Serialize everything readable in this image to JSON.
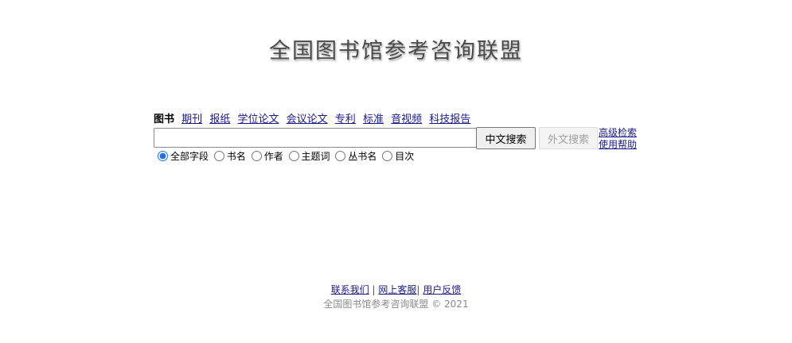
{
  "site": {
    "title": "全国图书馆参考咨询联盟"
  },
  "tabs": [
    {
      "label": "图书",
      "active": true
    },
    {
      "label": "期刊"
    },
    {
      "label": "报纸"
    },
    {
      "label": "学位论文"
    },
    {
      "label": "会议论文"
    },
    {
      "label": "专利"
    },
    {
      "label": "标准"
    },
    {
      "label": "音视频"
    },
    {
      "label": "科技报告"
    }
  ],
  "search": {
    "value": "",
    "placeholder": "",
    "chinese_button": "中文搜索",
    "foreign_button": "外文搜索",
    "advanced_link": "高级检索",
    "help_link": "使用帮助"
  },
  "fields": [
    {
      "label": "全部字段",
      "checked": true
    },
    {
      "label": "书名",
      "checked": false
    },
    {
      "label": "作者",
      "checked": false
    },
    {
      "label": "主题词",
      "checked": false
    },
    {
      "label": "丛书名",
      "checked": false
    },
    {
      "label": "目次",
      "checked": false
    }
  ],
  "footer": {
    "contact": "联系我们",
    "separator": "|",
    "online_service": "网上客服",
    "feedback": "用户反馈",
    "copyright": "全国图书馆参考咨询联盟 © 2021"
  },
  "colors": {
    "link": "#1a1a8c",
    "radio_accent": "#1a73e8",
    "logo_text": "#4a4a4a"
  }
}
